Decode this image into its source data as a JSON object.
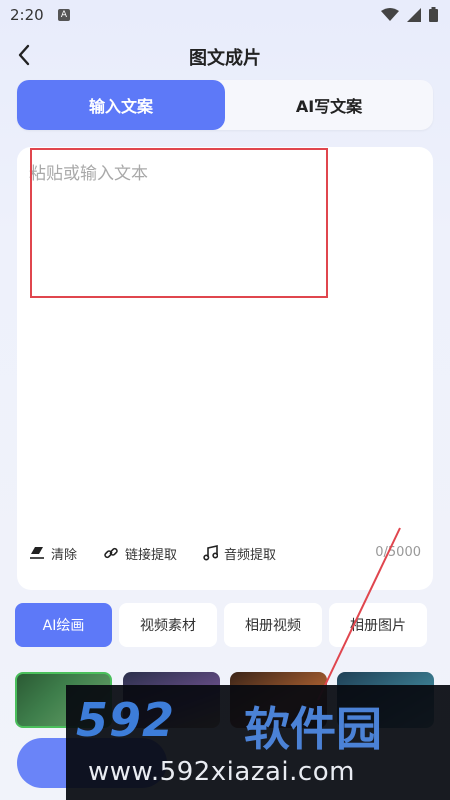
{
  "status": {
    "time": "2:20",
    "notif_letter": "A",
    "icons": [
      "wifi-icon",
      "signal-icon",
      "battery-icon"
    ]
  },
  "header": {
    "title": "图文成片",
    "back_icon": "back-arrow-icon"
  },
  "tabs": [
    {
      "label": "输入文案",
      "active": true
    },
    {
      "label": "AI写文案",
      "active": false
    }
  ],
  "editor": {
    "placeholder": "粘贴或输入文本",
    "value": "",
    "char_count": "0/5000",
    "tools": [
      {
        "label": "清除",
        "icon": "eraser-icon"
      },
      {
        "label": "链接提取",
        "icon": "link-icon"
      },
      {
        "label": "音频提取",
        "icon": "music-icon"
      }
    ]
  },
  "categories": [
    {
      "label": "AI绘画",
      "active": true
    },
    {
      "label": "视频素材",
      "active": false
    },
    {
      "label": "相册视频",
      "active": false
    },
    {
      "label": "相册图片",
      "active": false
    }
  ],
  "watermark": {
    "logo_digits": "592",
    "logo_text": "软件园",
    "url": "www.592xiazai.com"
  },
  "colors": {
    "accent": "#5d79f8",
    "highlight_border": "#e0464e",
    "watermark_blue": "#3d7dd9"
  }
}
